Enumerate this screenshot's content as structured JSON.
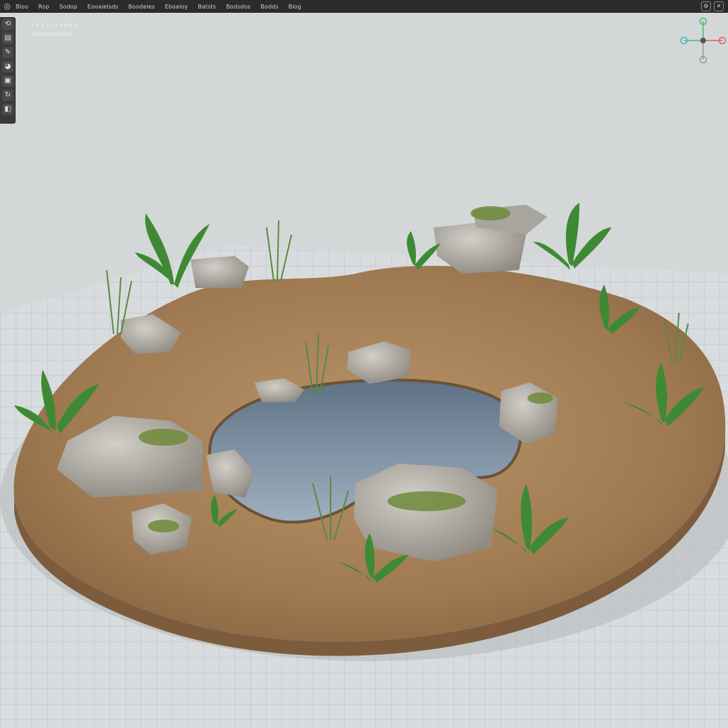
{
  "menubar": {
    "logo_icon": "app-logo-icon",
    "items": [
      "Bloo",
      "Rop",
      "Sodop",
      "Eooaielsds",
      "Boodeles",
      "Eboaloy",
      "Batsts",
      "Bodsdos",
      "Bodds",
      "Blog"
    ],
    "right_icons": [
      "settings-icon",
      "close-icon"
    ]
  },
  "toolbar": {
    "tools": [
      {
        "name": "rotate-tool",
        "glyph": "⟲"
      },
      {
        "name": "layers-tool",
        "glyph": "▤"
      },
      {
        "name": "brush-tool",
        "glyph": "✎"
      },
      {
        "name": "material-tool",
        "glyph": "◕"
      },
      {
        "name": "clipboard-tool",
        "glyph": "▣"
      },
      {
        "name": "refresh-tool",
        "glyph": "↻"
      },
      {
        "name": "bucket-tool",
        "glyph": "◧"
      }
    ]
  },
  "viewport": {
    "overlay_line1": "5 5 3 5 2 0 9 8 8 9",
    "overlay_line2": "3003000000000"
  },
  "gizmo": {
    "axes": [
      {
        "axis": "y",
        "color": "#3fc06a"
      },
      {
        "axis": "x",
        "color": "#e06060"
      },
      {
        "axis": "-x",
        "color": "#40b8b0"
      },
      {
        "axis": "-y",
        "color": "#9a9a9a"
      }
    ]
  },
  "colors": {
    "sky": "#d4d7d8",
    "ground": "#a9845c",
    "water": "#7d93a6",
    "rock": "#b9b5ad",
    "moss": "#6f8a3a",
    "plant": "#3e8a34"
  }
}
